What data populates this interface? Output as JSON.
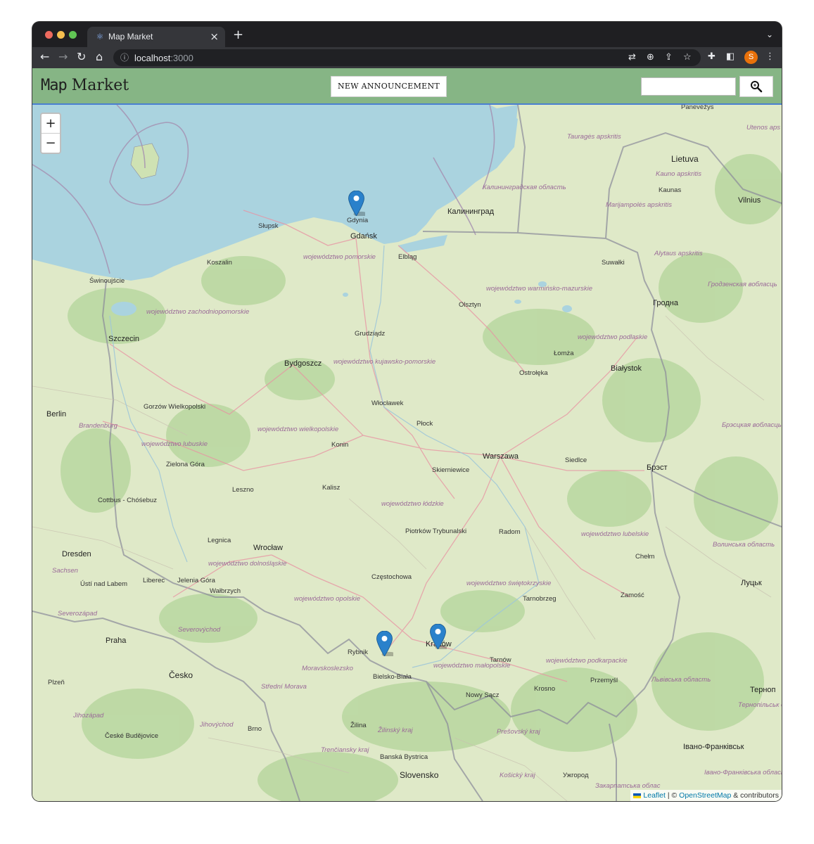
{
  "browser": {
    "tab_title": "Map Market",
    "url_host": "localhost",
    "url_port": ":3000",
    "avatar_letter": "S"
  },
  "app": {
    "brand_word1": "Map",
    "brand_word2": "Market",
    "new_announcement_label": "NEW ANNOUNCEMENT",
    "search_value": ""
  },
  "map": {
    "zoom_in": "+",
    "zoom_out": "−",
    "attribution_leaflet": "Leaflet",
    "attribution_sep": " | © ",
    "attribution_osm": "OpenStreetMap",
    "attribution_tail": " & contributors",
    "markers": [
      "Gdynia",
      "Katowice area",
      "Kraków"
    ],
    "labels": {
      "panevezys": "Panevėžys",
      "taurages": "Tauragės apskritis",
      "utenos": "Utenos aps",
      "lietuva": "Lietuva",
      "kauno_aps": "Kauno apskritis",
      "kaunas": "Kaunas",
      "kaliningrad_obl": "Калининградская область",
      "kaliningrad": "Калининград",
      "marijampoles": "Marijampolės apskritis",
      "vilnius": "Vilnius",
      "gdynia": "Gdynia",
      "gdansk": "Gdańsk",
      "slupsk": "Słupsk",
      "elblag": "Elbląg",
      "koszalin": "Koszalin",
      "pomorskie": "województwo pomorskie",
      "alytaus": "Alytaus apskritis",
      "suwalki": "Suwałki",
      "swinoujscie": "Świnoujście",
      "grodno_obl": "Гродзенская вобласць",
      "olsztyn": "Olsztyn",
      "warminsko": "województwo warmińsko-mazurskie",
      "grodno": "Гродна",
      "zachodnio": "województwo zachodniopomorskie",
      "grudziadz": "Grudziądz",
      "podlaskie": "województwo podlaskie",
      "szczecin": "Szczecin",
      "lomza": "Łomża",
      "bydgoszcz": "Bydgoszcz",
      "kujawsko": "województwo kujawsko-pomorskie",
      "ostroleka": "Ostrołęka",
      "bialystok": "Białystok",
      "wloclawek": "Włocławek",
      "gorzow": "Gorzów Wielkopolski",
      "berlin": "Berlin",
      "plock": "Płock",
      "brandenburg": "Brandenburg",
      "brest_obl": "Брэсцкая вобласць",
      "wielkopolskie": "województwo wielkopolskie",
      "lubuskie": "województwo lubuskie",
      "konin": "Konin",
      "warszawa": "Warszawa",
      "siedlce": "Siedlce",
      "skierniewice": "Skierniewice",
      "zielona": "Zielona Góra",
      "brest": "Брэст",
      "kalisz": "Kalisz",
      "leszno": "Leszno",
      "cottbus": "Cottbus - Chóśebuz",
      "lodzkie": "województwo łódzkie",
      "piotrkow": "Piotrków Trybunalski",
      "radom": "Radom",
      "lubelskie": "województwo lubelskie",
      "volyn": "Волинська область",
      "legnica": "Legnica",
      "wroclaw": "Wrocław",
      "dresden": "Dresden",
      "chelm": "Chełm",
      "dolnoslaskie": "województwo dolnośląskie",
      "sachsen": "Sachsen",
      "czestochowa": "Częstochowa",
      "swietokrzyskie": "województwo świętokrzyskie",
      "lutsk": "Луцьк",
      "liberec": "Liberec",
      "jelenia": "Jelenia Góra",
      "usti": "Ústí nad Labem",
      "walbrzych": "Wałbrzych",
      "opolskie": "województwo opolskie",
      "tarnobrzeg": "Tarnobrzeg",
      "zamosc": "Zamość",
      "severozapad": "Severozápad",
      "severovychod": "Severovýchod",
      "rybnik": "Rybnik",
      "krakow": "Kraków",
      "tarnow": "Tarnów",
      "praha": "Praha",
      "podkarpackie": "województwo podkarpackie",
      "moravskoslezsko": "Moravskoslezsko",
      "bielsko": "Bielsko-Biała",
      "malopolskie": "województwo małopolskie",
      "przemysl": "Przemyśl",
      "lviv": "Львівська область",
      "ternopil": "Терноп",
      "cesko": "Česko",
      "plzen": "Plzeň",
      "stredni": "Střední Morava",
      "krosno": "Krosno",
      "nowy_sacz": "Nowy Sącz",
      "ternopil_obl": "Тернопільськ область",
      "jihozapad": "Jihozápad",
      "jihovychod": "Jihovýchod",
      "brno": "Brno",
      "zilina": "Žilina",
      "zilinsky": "Žilinský kraj",
      "presovsky": "Prešovský kraj",
      "ceske": "České Budějovice",
      "frankivsk": "Івано-Франківськ",
      "trenciansky": "Trenčiansky kraj",
      "banska": "Banská Bystrica",
      "slovensko": "Slovensko",
      "kosicky": "Košický kraj",
      "uzhhorod": "Ужгород",
      "zakarpatska": "Закарпатська облас",
      "frankivsk_obl": "Івано-Франківська область"
    }
  },
  "colors": {
    "header_green": "#86b585",
    "water": "#aad3df",
    "land": "#dfe9c8",
    "marker_blue": "#2a81cb"
  }
}
